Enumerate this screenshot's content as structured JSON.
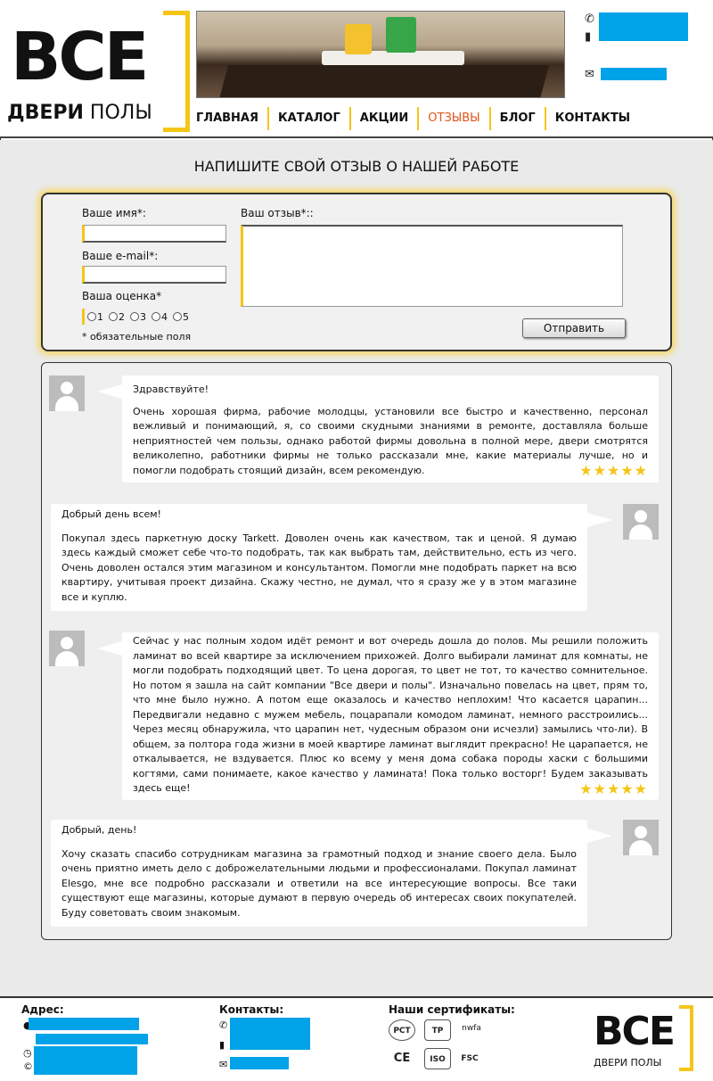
{
  "header": {
    "logo_big": "ВСЕ",
    "logo_sub_bold": "ДВЕРИ",
    "logo_sub_rest": " ПОЛЫ",
    "nav": [
      {
        "label": "ГЛАВНАЯ"
      },
      {
        "label": "КАТАЛОГ"
      },
      {
        "label": "АКЦИИ"
      },
      {
        "label": "ОТЗЫВЫ",
        "active": true
      },
      {
        "label": "БЛОГ"
      },
      {
        "label": "КОНТАКТЫ"
      }
    ],
    "icons": [
      "phone-icon",
      "mobile-icon",
      "email-icon"
    ]
  },
  "form": {
    "title": "НАПИШИТЕ СВОЙ ОТЗЫВ О НАШЕЙ РАБОТЕ",
    "name_label": "Ваше имя*:",
    "email_label": "Ваше e-mail*:",
    "review_label": "Ваш отзыв*::",
    "rating_label": "Ваша оценка*",
    "rating_options": [
      "1",
      "2",
      "3",
      "4",
      "5"
    ],
    "required_note": "* обязательные поля",
    "submit_label": "Отправить"
  },
  "reviews": [
    {
      "side": "left",
      "greeting": "Здравствуйте!",
      "text": "Очень хорошая фирма, рабочие молодцы, установили все быстро и качественно, персонал вежливый и понимающий, я, со своими скудными знаниями в ремонте, доставляла больше неприятностей чем пользы, однако работой фирмы довольна в полной мере, двери смотрятся великолепно, работники фирмы не только рассказали мне, какие материалы лучше, но и помогли подобрать стоящий дизайн, всем рекомендую.",
      "stars": "★★★★★",
      "rating": 5
    },
    {
      "side": "right",
      "greeting": "Добрый день всем!",
      "text": "Покупал здесь паркетную доску Tarkett. Доволен очень как качеством, так и ценой.  Я думаю здесь каждый сможет себе что-то подобрать, так как выбрать там, действительно, есть из чего.  Очень доволен остался этим магазином и консультантом. Помогли мне подобрать паркет на всю квартиру, учитывая проект дизайна. Скажу честно, не думал, что я сразу же у в этом магазине все и куплю."
    },
    {
      "side": "left",
      "greeting": "",
      "text": "Сейчас у нас полным ходом идёт ремонт и вот очередь дошла до полов. Мы решили положить ламинат во всей квартире за исключением прихожей. Долго выбирали ламинат для комнаты, не могли подобрать подходящий цвет. То цена дорогая, то цвет не тот, то качество сомнительное. Но потом я зашла на сайт компании \"Все двери и полы\". Изначально повелась на цвет, прям то, что мне было нужно. А потом еще оказалось и качество неплохим! Что касается царапин... Передвигали недавно с мужем мебель, поцарапали комодом ламинат, немного расстроились... Через месяц обнаружила, что царапин нет, чудесным образом они исчезли) замылись что-ли). В общем, за полтора года жизни в моей квартире ламинат выглядит прекрасно! Не царапается, не откалывается, не вздувается. Плюс ко всему у меня дома собака породы хаски с большими когтями, сами понимаете, какое качество у ламината! Пока только восторг! Будем заказывать здесь еще!",
      "stars": "★★★★★",
      "rating": 5
    },
    {
      "side": "right",
      "greeting": "Добрый, день!",
      "text": "Хочу сказать спасибо сотрудникам магазина за грамотный подход и знание своего дела. Было очень приятно иметь дело с доброжелательными людьми и профессионалами. Покупал ламинат Elesgo, мне все подробно рассказали и ответили на все интересующие вопросы. Все таки существуют еще магазины, которые думают в первую очередь об интересах своих покупателей. Буду советовать своим знакомым."
    }
  ],
  "footer": {
    "address_title": "Адрес:",
    "contacts_title": "Контакты:",
    "certs_title": "Наши сертификаты:",
    "certs": [
      "РСТ",
      "ТР",
      "nwfa",
      "CE",
      "ISO",
      "FSC"
    ],
    "logo_big": "ВСЕ",
    "logo_sub": "ДВЕРИ ПОЛЫ"
  },
  "colors": {
    "accent_yellow": "#f5c518",
    "active_nav": "#e3541a",
    "redaction_blue": "#00a2e8",
    "page_bg": "#eaeaea"
  }
}
